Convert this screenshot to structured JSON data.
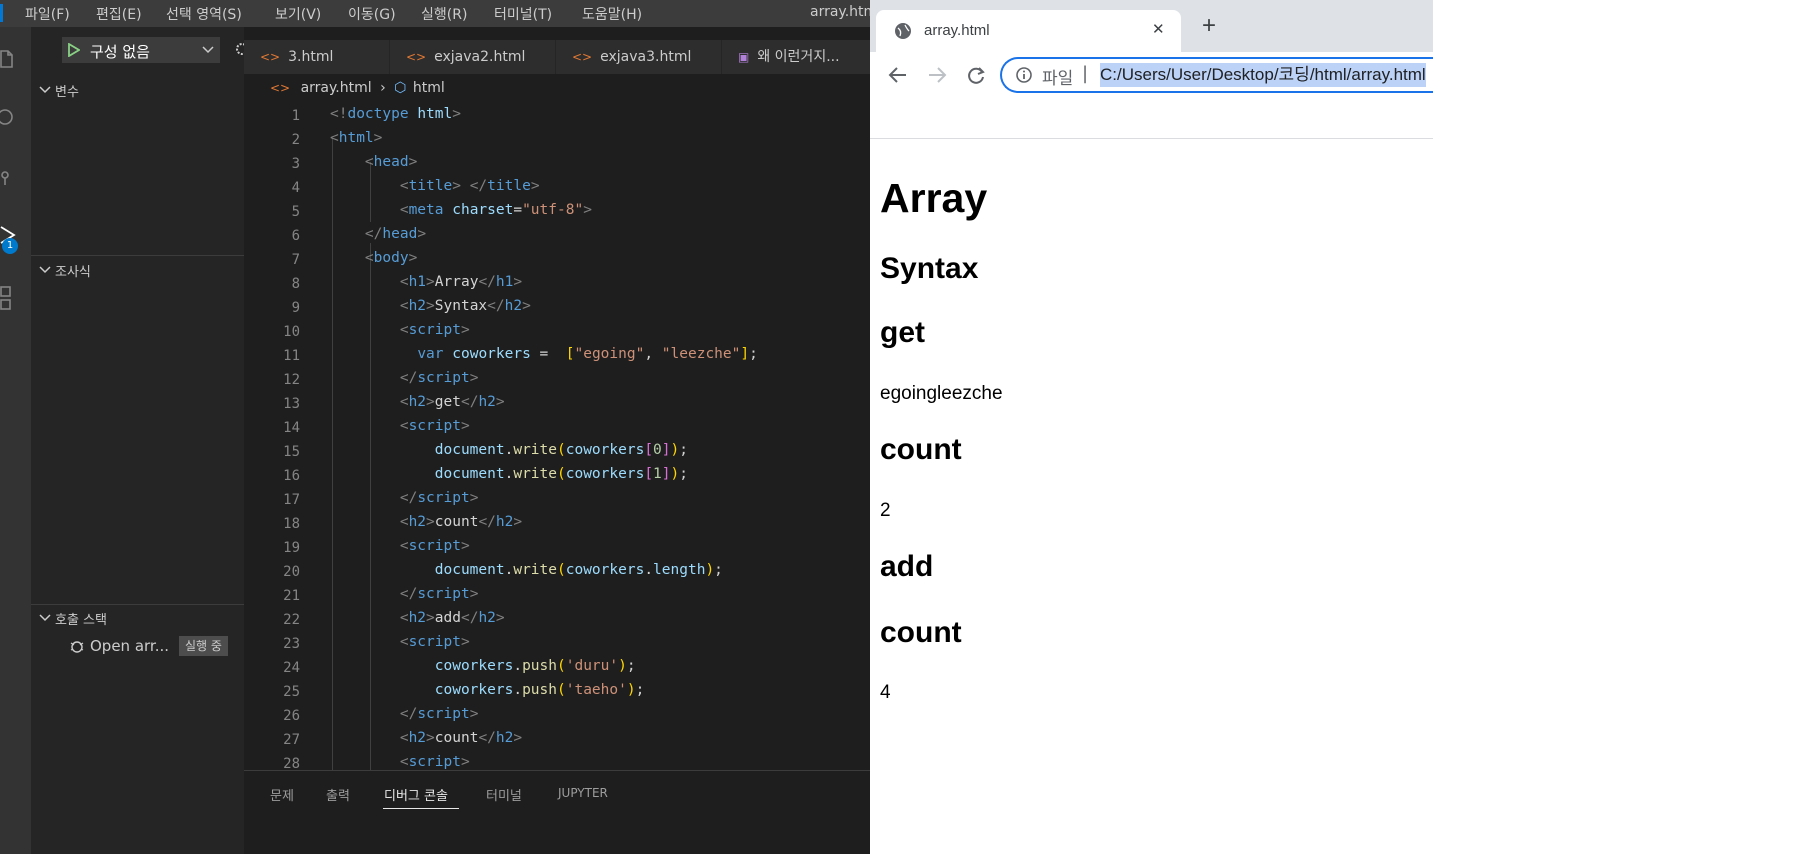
{
  "vscode": {
    "menu": [
      "파일(F)",
      "편집(E)",
      "선택 영역(S)",
      "보기(V)",
      "이동(G)",
      "실행(R)",
      "터미널(T)",
      "도움말(H)"
    ],
    "window_title": "array.html",
    "run_config": "구성 없음",
    "sidebar": {
      "variables_title": "변수",
      "watch_title": "조사식",
      "callstack_title": "호출 스택",
      "callstack_item": "Open arr...",
      "callstack_status": "실행 중",
      "debug_badge": "1"
    },
    "tabs": [
      "3.html",
      "exjava2.html",
      "exjava3.html",
      "왜 이런거지..."
    ],
    "breadcrumb": {
      "file": "array.html",
      "symbol": "html"
    },
    "line_numbers": [
      "1",
      "2",
      "3",
      "4",
      "5",
      "6",
      "7",
      "8",
      "9",
      "10",
      "11",
      "12",
      "13",
      "14",
      "15",
      "16",
      "17",
      "18",
      "19",
      "20",
      "21",
      "22",
      "23",
      "24",
      "25",
      "26",
      "27",
      "28"
    ],
    "panel_tabs": [
      "문제",
      "출력",
      "디버그 콘솔",
      "터미널",
      "JUPYTER"
    ],
    "active_panel_tab": "디버그 콘솔"
  },
  "chrome": {
    "tab_title": "array.html",
    "new_tab": "+",
    "close": "✕",
    "address_prefix": "파일",
    "address": "C:/Users/User/Desktop/코딩/html/array.html",
    "page": {
      "h1": "Array",
      "h2_syntax": "Syntax",
      "h2_get": "get",
      "get_output": "egoingleezche",
      "h2_count1": "count",
      "count1_output": "2",
      "h2_add": "add",
      "h2_count2": "count",
      "count2_output": "4"
    }
  }
}
